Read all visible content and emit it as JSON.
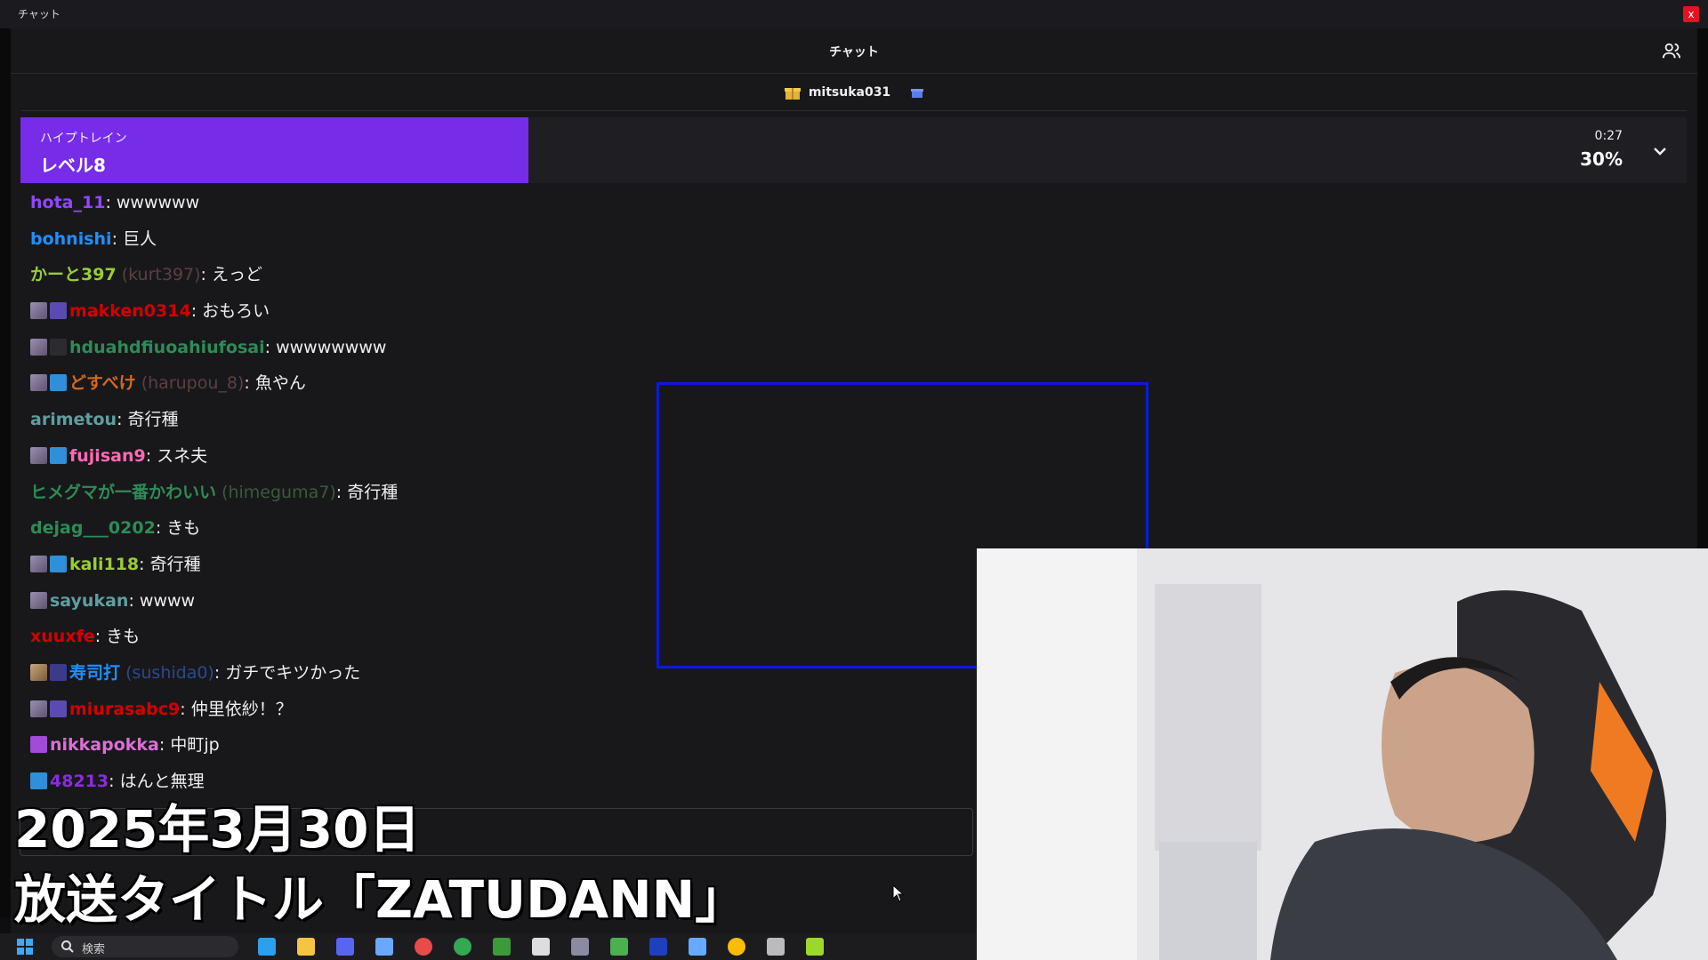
{
  "window": {
    "title": "チャット",
    "close_glyph": "x"
  },
  "chat": {
    "header_title": "チャット",
    "gifter": {
      "name": "mitsuka031"
    },
    "hype_train": {
      "label": "ハイプトレイン",
      "level": "レベル8",
      "timer": "0:27",
      "percent": "30%",
      "progress": 0.3
    },
    "messages": [
      {
        "badges": [],
        "user": "hota_11",
        "user_color": "#9147ff",
        "login": "",
        "text": "wwwwww"
      },
      {
        "badges": [],
        "user": "bohnishi",
        "user_color": "#1e90ff",
        "login": "",
        "text": "巨人"
      },
      {
        "badges": [],
        "user": "かーと397",
        "user_color": "#9acd32",
        "login": "(kurt397)",
        "text": "えっど"
      },
      {
        "badges": [
          "face",
          "gift"
        ],
        "user": "makken0314",
        "user_color": "#d40000",
        "login": "",
        "text": "おもろい"
      },
      {
        "badges": [
          "face",
          "speaker"
        ],
        "user": "hduahdfiuoahiufosai",
        "user_color": "#2e8b57",
        "login": "",
        "text": "wwwwwwww"
      },
      {
        "badges": [
          "face",
          "crown"
        ],
        "user": "どすべけ",
        "user_color": "#d2691e",
        "login": "(harupou_8)",
        "text": "魚やん"
      },
      {
        "badges": [],
        "user": "arimetou",
        "user_color": "#5f9ea0",
        "login": "",
        "text": "奇行種"
      },
      {
        "badges": [
          "face",
          "crown"
        ],
        "user": "fujisan9",
        "user_color": "#ff69b4",
        "login": "",
        "text": "スネ夫"
      },
      {
        "badges": [],
        "user": "ヒメグマが一番かわいい",
        "user_color": "#2e8b57",
        "login": "(himeguma7)",
        "text": "奇行種"
      },
      {
        "badges": [],
        "user": "dejag___0202",
        "user_color": "#2e8b57",
        "login": "",
        "text": "きも"
      },
      {
        "badges": [
          "face",
          "crown"
        ],
        "user": "kali118",
        "user_color": "#9acd32",
        "login": "",
        "text": "奇行種"
      },
      {
        "badges": [
          "face"
        ],
        "user": "sayukan",
        "user_color": "#5f9ea0",
        "login": "",
        "text": "wwww"
      },
      {
        "badges": [],
        "user": "xuuxfe",
        "user_color": "#d40000",
        "login": "",
        "text": "きも"
      },
      {
        "badges": [
          "face2",
          "sub"
        ],
        "user": "寿司打",
        "user_color": "#1e90ff",
        "login": "(sushida0)",
        "text": "ガチでキツかった"
      },
      {
        "badges": [
          "face",
          "gift"
        ],
        "user": "miurasabc9",
        "user_color": "#d40000",
        "login": "",
        "text": "仲里依紗！？"
      },
      {
        "badges": [
          "purple"
        ],
        "user": "nikkapokka",
        "user_color": "#da70d6",
        "login": "",
        "text": "中町jp"
      },
      {
        "badges": [
          "crown"
        ],
        "user": "48213",
        "user_color": "#8a2be2",
        "login": "",
        "text": "はんと無理"
      }
    ]
  },
  "overlay": {
    "date": "2025年3月30日",
    "title": "放送タイトル「ZATUDANN」"
  },
  "taskbar": {
    "search_placeholder": "検索",
    "icons": [
      "start-icon",
      "edge-icon",
      "file-explorer-icon",
      "discord-icon",
      "notepad-icon",
      "obs-icon",
      "chrome-icon",
      "minecraft-icon",
      "capcut-icon",
      "keyboard-icon",
      "drive-icon",
      "monitor-icon",
      "steam-icon",
      "chrome-icon",
      "app-icon",
      "media-player-icon"
    ]
  },
  "colors": {
    "hype_purple": "#772ce8",
    "background": "#18181b",
    "selection_border": "#0a1adf"
  }
}
